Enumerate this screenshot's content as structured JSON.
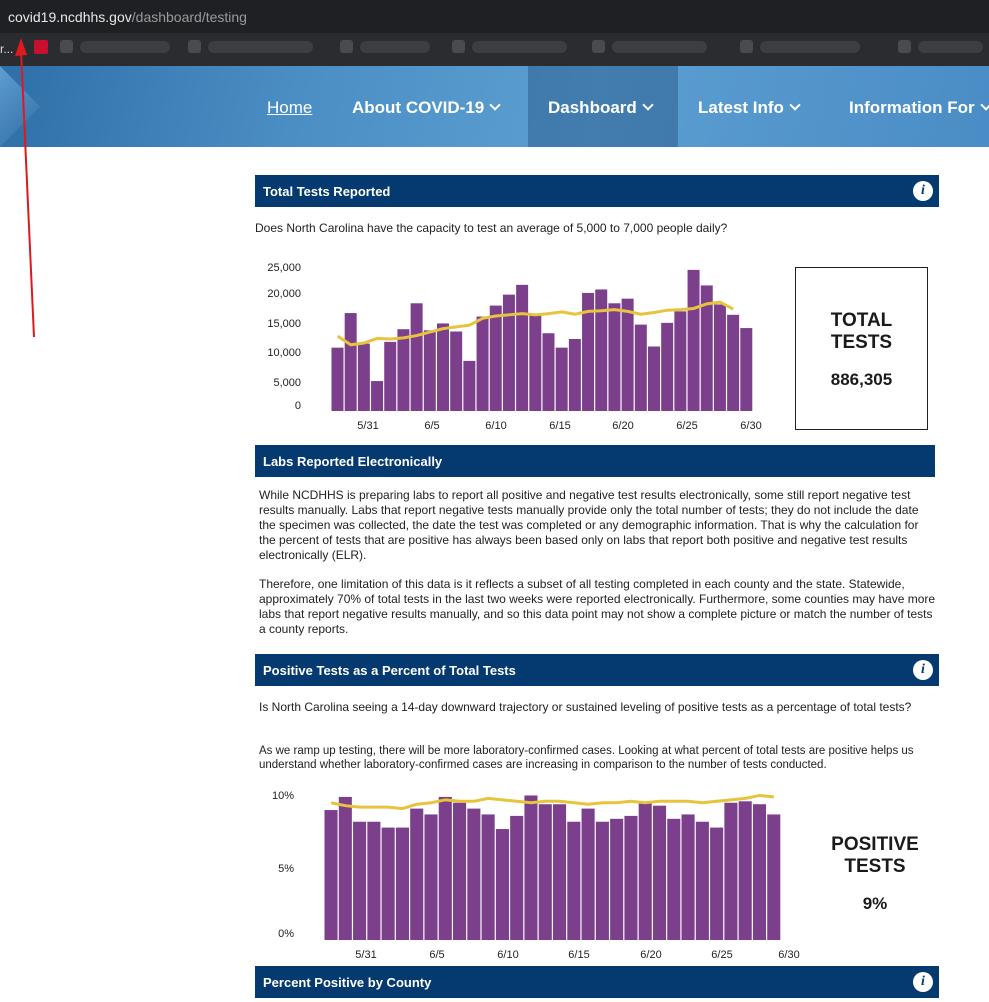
{
  "browser": {
    "url_host": "covid19.ncdhhs.gov",
    "url_path": "/dashboard/testing",
    "bookmark_text": "r..."
  },
  "nav": {
    "items": [
      {
        "label": "Home",
        "dropdown": false
      },
      {
        "label": "About COVID-19",
        "dropdown": true
      },
      {
        "label": "Dashboard",
        "dropdown": true
      },
      {
        "label": "Latest Info",
        "dropdown": true
      },
      {
        "label": "Information For",
        "dropdown": true
      }
    ]
  },
  "total_tests": {
    "header": "Total Tests Reported",
    "question": "Does North Carolina have the capacity to test an average of 5,000 to 7,000 people daily?",
    "stat_label_1": "TOTAL",
    "stat_label_2": "TESTS",
    "stat_value": "886,305"
  },
  "labs": {
    "header": "Labs Reported Electronically",
    "para1": "While NCDHHS is preparing labs to report all positive and negative test results electronically, some still report negative test results manually. Labs that report negative tests manually provide only the total number of tests; they do not include the date the specimen was collected, the date the test was completed or any demographic information. That is why the calculation for the percent of tests that are positive has always been based only on labs that report both positive and negative test results electronically (ELR).",
    "para2": "Therefore, one limitation of this data is it reflects a subset of all testing completed in each county and the state. Statewide, approximately 70% of total tests in the last two weeks were reported electronically. Furthermore, some counties may have more labs that report negative results manually, and so this data point may not show a complete picture or match the number of tests a county reports."
  },
  "positive": {
    "header": "Positive Tests as a Percent of Total Tests",
    "question": "Is North Carolina seeing a 14-day downward trajectory or sustained leveling of positive tests as a percentage of total tests?",
    "note": "As we ramp up testing, there will be more laboratory-confirmed cases. Looking at what percent of total tests are positive helps us understand whether laboratory-confirmed cases are increasing in comparison to the number of tests conducted.",
    "stat_label_1": "POSITIVE",
    "stat_label_2": "TESTS",
    "stat_value": "9%"
  },
  "county": {
    "header": "Percent Positive by County"
  },
  "colors": {
    "bar": "#7b3f8c",
    "line": "#e8c33c",
    "header_bg": "#053a70"
  },
  "chart_data": [
    {
      "type": "bar",
      "x_tick_labels": [
        "5/31",
        "6/5",
        "6/10",
        "6/15",
        "6/20",
        "6/25",
        "6/30"
      ],
      "y_tick_labels": [
        "25,000",
        "20,000",
        "15,000",
        "10,000",
        "5,000",
        "0"
      ],
      "ylim": [
        0,
        25000
      ],
      "series": [
        {
          "values": [
            11000,
            17000,
            11700,
            5200,
            12000,
            14200,
            18700,
            14000,
            15200,
            13800,
            8700,
            16400,
            18300,
            20200,
            21900,
            16900,
            13500,
            11000,
            12500,
            20500,
            21100,
            18700,
            19500,
            15000,
            11200,
            15300,
            17300,
            24500,
            21800,
            18500,
            16700,
            14400
          ]
        },
        {
          "type": "line",
          "values": [
            13000,
            11500,
            11800,
            12600,
            12500,
            12700,
            13100,
            13700,
            14300,
            14600,
            14900,
            16100,
            16500,
            16700,
            16900,
            16700,
            16900,
            17200,
            16800,
            17300,
            17400,
            17600,
            17300,
            16800,
            17100,
            17500,
            17600,
            17800,
            18600,
            18900,
            17700
          ]
        }
      ]
    },
    {
      "type": "bar",
      "x_tick_labels": [
        "5/31",
        "6/5",
        "6/10",
        "6/15",
        "6/20",
        "6/25",
        "6/30"
      ],
      "y_tick_labels": [
        "10%",
        "5%",
        "0%"
      ],
      "ylim": [
        0,
        10
      ],
      "series": [
        {
          "values": [
            8.9,
            9.8,
            8.1,
            8.1,
            7.7,
            7.7,
            9.0,
            8.6,
            9.8,
            9.4,
            9.0,
            8.6,
            7.6,
            8.5,
            9.9,
            9.3,
            9.3,
            8.1,
            9.0,
            8.1,
            8.3,
            8.5,
            9.4,
            9.2,
            8.3,
            8.6,
            8.1,
            7.7,
            9.4,
            9.5,
            9.3,
            8.6
          ]
        },
        {
          "type": "line",
          "values": [
            9.4,
            9.2,
            9.1,
            9.1,
            9.1,
            9.0,
            9.3,
            9.4,
            9.6,
            9.5,
            9.5,
            9.7,
            9.6,
            9.5,
            9.4,
            9.5,
            9.5,
            9.4,
            9.3,
            9.4,
            9.4,
            9.5,
            9.4,
            9.5,
            9.5,
            9.5,
            9.4,
            9.5,
            9.6,
            9.7,
            9.9,
            9.8
          ]
        }
      ]
    }
  ]
}
